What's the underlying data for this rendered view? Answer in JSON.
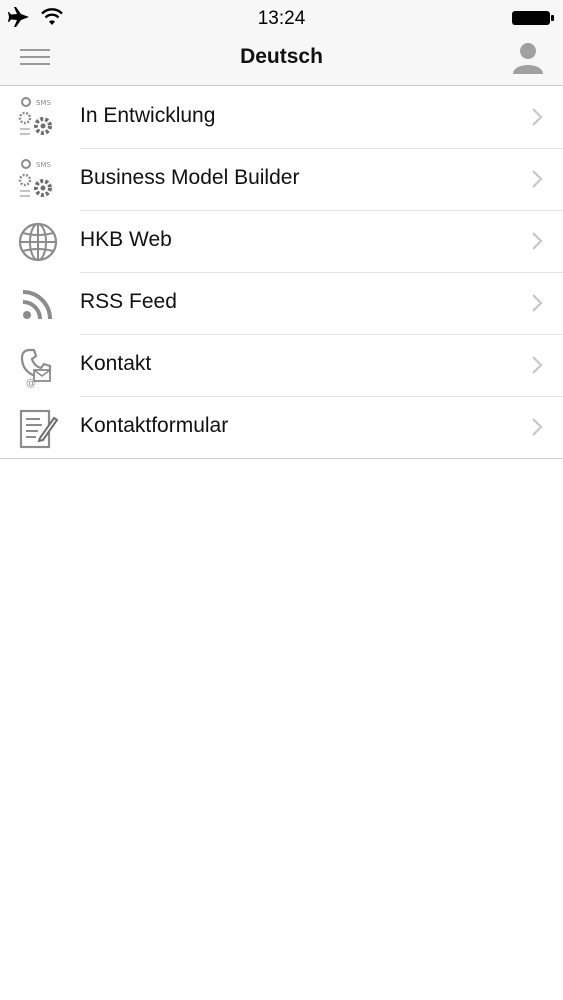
{
  "status_bar": {
    "time": "13:24",
    "airplane_icon": "airplane-icon",
    "wifi_icon": "wifi-icon",
    "battery_icon": "battery-icon"
  },
  "nav": {
    "title": "Deutsch",
    "menu_icon": "hamburger-menu-icon",
    "user_icon": "user-profile-icon"
  },
  "menu_items": [
    {
      "label": "In Entwicklung",
      "icon": "gears-sms-icon"
    },
    {
      "label": "Business Model Builder",
      "icon": "gears-sms-icon"
    },
    {
      "label": "HKB Web",
      "icon": "globe-icon"
    },
    {
      "label": "RSS Feed",
      "icon": "rss-icon"
    },
    {
      "label": "Kontakt",
      "icon": "phone-mail-icon"
    },
    {
      "label": "Kontaktformular",
      "icon": "form-edit-icon"
    }
  ],
  "colors": {
    "bar_background": "#f7f7f7",
    "icon_gray": "#8c8c8c",
    "chevron": "#c7c7cc",
    "separator": "#e3e3e3"
  }
}
